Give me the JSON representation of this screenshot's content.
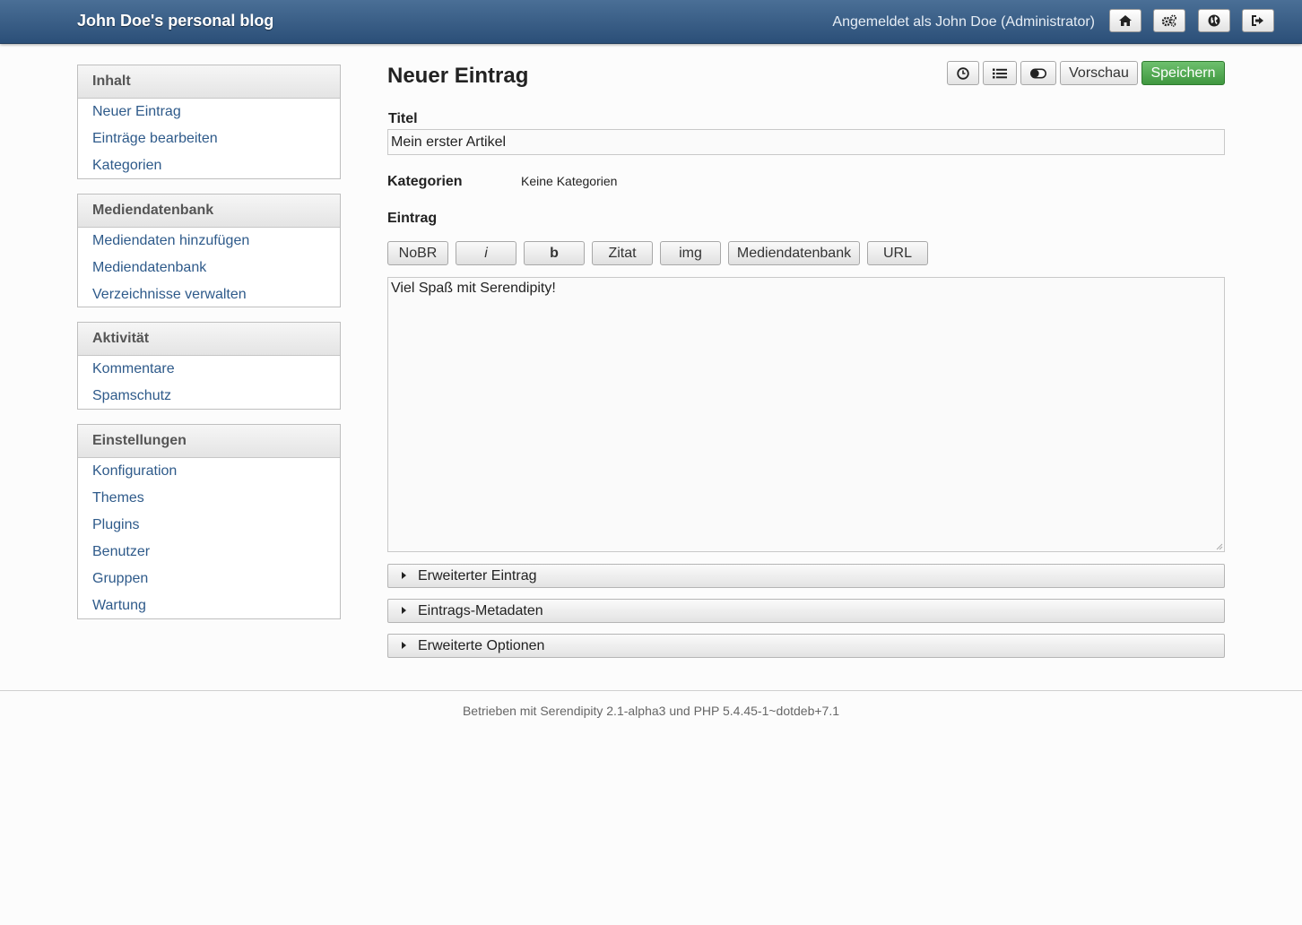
{
  "header": {
    "blog_title": "John Doe's personal blog",
    "logged_in": "Angemeldet als John Doe (Administrator)",
    "buttons": [
      "home-icon",
      "settings-gears-icon",
      "globe-icon",
      "logout-icon"
    ]
  },
  "sidebar": {
    "sections": [
      {
        "title": "Inhalt",
        "items": [
          "Neuer Eintrag",
          "Einträge bearbeiten",
          "Kategorien"
        ]
      },
      {
        "title": "Mediendatenbank",
        "items": [
          "Mediendaten hinzufügen",
          "Mediendatenbank",
          "Verzeichnisse verwalten"
        ]
      },
      {
        "title": "Aktivität",
        "items": [
          "Kommentare",
          "Spamschutz"
        ]
      },
      {
        "title": "Einstellungen",
        "items": [
          "Konfiguration",
          "Themes",
          "Plugins",
          "Benutzer",
          "Gruppen",
          "Wartung"
        ]
      }
    ]
  },
  "main": {
    "page_title": "Neuer Eintrag",
    "toolbar": {
      "icons": [
        "clock-icon",
        "list-icon",
        "toggle-icon"
      ],
      "preview_label": "Vorschau",
      "save_label": "Speichern"
    },
    "title_label": "Titel",
    "title_value": "Mein erster Artikel",
    "categories_label": "Kategorien",
    "categories_value": "Keine Kategorien",
    "entry_label": "Eintrag",
    "format_buttons": [
      "NoBR",
      "i",
      "b",
      "Zitat",
      "img",
      "Mediendatenbank",
      "URL"
    ],
    "entry_body": "Viel Spaß mit Serendipity!",
    "accordions": [
      "Erweiterter Eintrag",
      "Eintrags-Metadaten",
      "Erweiterte Optionen"
    ]
  },
  "footer": {
    "text": "Betrieben mit Serendipity 2.1-alpha3 und PHP 5.4.45-1~dotdeb+7.1"
  },
  "colors": {
    "header_top": "#4a6f96",
    "header_bottom": "#2b4f78",
    "link": "#2e5a8a",
    "save_button": "#4fa64f"
  }
}
